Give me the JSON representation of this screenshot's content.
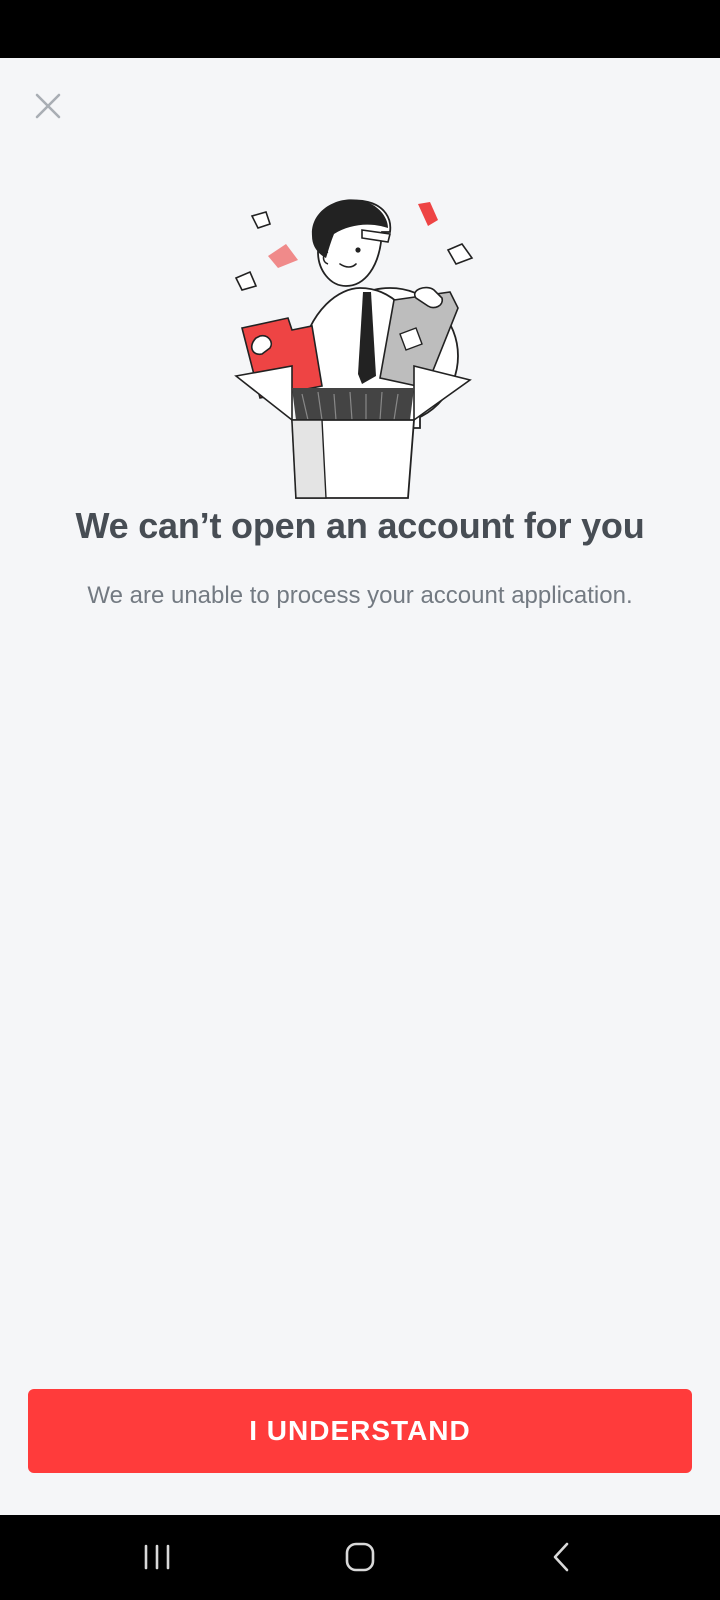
{
  "close": {
    "icon": "close-icon"
  },
  "illustration": {
    "icon": "person-in-box-with-folders-illustration",
    "accent_color": "#ee4444"
  },
  "content": {
    "title": "We can’t open an account for you",
    "subtitle": "We are unable to process your account application."
  },
  "actions": {
    "primary_label": "I UNDERSTAND",
    "primary_color": "#ff3b3b"
  },
  "navigation": {
    "recents_icon": "recent-apps-icon",
    "home_icon": "home-icon",
    "back_icon": "back-icon"
  }
}
